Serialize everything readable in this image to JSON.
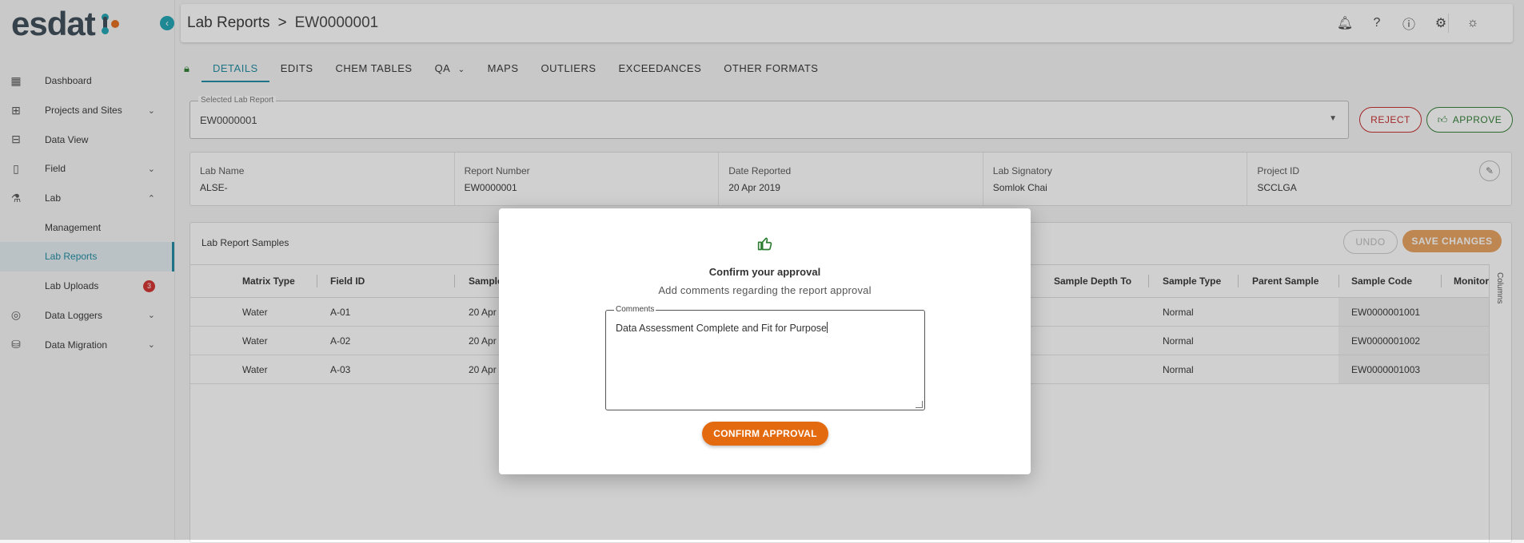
{
  "logo": {
    "text": "esdat"
  },
  "sidebar": {
    "items": [
      {
        "label": "Dashboard",
        "icon": "dashboard-icon"
      },
      {
        "label": "Projects and Sites",
        "icon": "map-icon",
        "expandable": true
      },
      {
        "label": "Data View",
        "icon": "data-view-icon"
      },
      {
        "label": "Field",
        "icon": "phone-icon",
        "expandable": true
      },
      {
        "label": "Lab",
        "icon": "flask-icon",
        "expandable": true,
        "expanded": true
      },
      {
        "label": "Management",
        "sub": true
      },
      {
        "label": "Lab Reports",
        "sub": true,
        "active": true
      },
      {
        "label": "Lab Uploads",
        "sub": true,
        "badge": "3"
      },
      {
        "label": "Data Loggers",
        "icon": "signal-icon",
        "expandable": true
      },
      {
        "label": "Data Migration",
        "icon": "database-icon",
        "expandable": true
      }
    ]
  },
  "header": {
    "section": "Lab Reports",
    "separator": ">",
    "current": "EW0000001",
    "icons": [
      "bell-icon",
      "help-icon",
      "info-icon",
      "gear-icon",
      "theme-icon"
    ]
  },
  "tabs": [
    "DETAILS",
    "EDITS",
    "CHEM TABLES",
    "QA",
    "MAPS",
    "OUTLIERS",
    "EXCEEDANCES",
    "OTHER FORMATS"
  ],
  "selected_report": {
    "label": "Selected Lab Report",
    "value": "EW0000001"
  },
  "actions": {
    "reject": "REJECT",
    "approve": "APPROVE"
  },
  "info": [
    {
      "key": "Lab Name",
      "value": "ALSE-"
    },
    {
      "key": "Report Number",
      "value": "EW0000001"
    },
    {
      "key": "Date Reported",
      "value": "20 Apr 2019"
    },
    {
      "key": "Lab Signatory",
      "value": "Somlok Chai"
    },
    {
      "key": "Project ID",
      "value": "SCCLGA"
    }
  ],
  "samples": {
    "title": "Lab Report Samples",
    "undo": "UNDO",
    "save": "SAVE CHANGES",
    "columns_label": "Columns",
    "headers": [
      "Matrix Type",
      "Field ID",
      "Sample",
      "Sample Depth To",
      "Sample Type",
      "Parent Sample",
      "Sample Code",
      "Monitor"
    ],
    "rows": [
      {
        "matrix": "Water",
        "field": "A-01",
        "date": "20 Apr",
        "type": "Normal",
        "code": "EW0000001001"
      },
      {
        "matrix": "Water",
        "field": "A-02",
        "date": "20 Apr",
        "type": "Normal",
        "code": "EW0000001002"
      },
      {
        "matrix": "Water",
        "field": "A-03",
        "date": "20 Apr",
        "type": "Normal",
        "code": "EW0000001003"
      }
    ]
  },
  "modal": {
    "title": "Confirm your approval",
    "subtitle": "Add comments regarding the report approval",
    "comments_label": "Comments",
    "comments_value": "Data Assessment Complete and Fit for Purpose",
    "confirm": "CONFIRM APPROVAL"
  },
  "colors": {
    "accent": "#1c8aa0",
    "approve": "#2e7d32",
    "reject": "#c62828",
    "confirm": "#e46a10"
  }
}
